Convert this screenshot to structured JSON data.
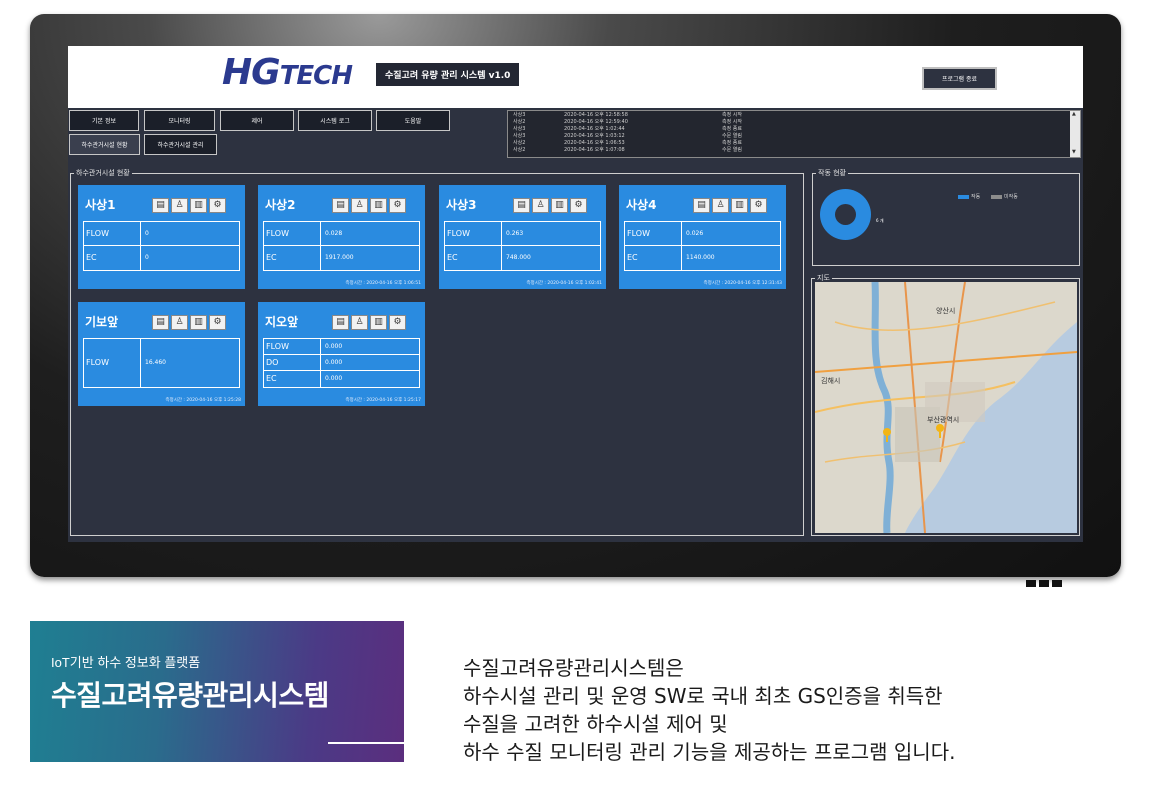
{
  "header": {
    "logo_main": "HG",
    "logo_rest": "TECH",
    "app_title": "수질고려 유량 관리 시스템 v1.0",
    "exit_label": "프로그램 종료"
  },
  "nav": {
    "row1": [
      "기본 정보",
      "모니터링",
      "제어",
      "시스템 로그",
      "도움말"
    ],
    "row2": [
      "하수관거시설 현황",
      "하수관거시설 관리"
    ]
  },
  "log": [
    {
      "site": "사상3",
      "time": "2020-04-16 오후 12:58:58",
      "event": "측정 시작"
    },
    {
      "site": "사상2",
      "time": "2020-04-16 오후 12:59:40",
      "event": "측정 시작"
    },
    {
      "site": "사상3",
      "time": "2020-04-16 오후 1:02:44",
      "event": "측정 종료"
    },
    {
      "site": "사상3",
      "time": "2020-04-16 오후 1:03:12",
      "event": "수문 열림"
    },
    {
      "site": "사상2",
      "time": "2020-04-16 오후 1:06:53",
      "event": "측정 종료"
    },
    {
      "site": "사상2",
      "time": "2020-04-16 오후 1:07:08",
      "event": "수문 열림"
    }
  ],
  "panels": {
    "facility_title": "하수관거시설 현황",
    "status_title": "작동 현황",
    "map_title": "지도"
  },
  "cards": [
    {
      "name": "사상1",
      "rows": [
        {
          "label": "FLOW",
          "value": "0"
        },
        {
          "label": "EC",
          "value": "0"
        }
      ],
      "time": ""
    },
    {
      "name": "사상2",
      "rows": [
        {
          "label": "FLOW",
          "value": "0.028"
        },
        {
          "label": "EC",
          "value": "1917.000"
        }
      ],
      "time": "측정시간 : 2020-04-16 오후 1:06:51"
    },
    {
      "name": "사상3",
      "rows": [
        {
          "label": "FLOW",
          "value": "0.263"
        },
        {
          "label": "EC",
          "value": "748.000"
        }
      ],
      "time": "측정시간 : 2020-04-16 오후 1:02:41"
    },
    {
      "name": "사상4",
      "rows": [
        {
          "label": "FLOW",
          "value": "0.026"
        },
        {
          "label": "EC",
          "value": "1140.000"
        }
      ],
      "time": "측정시간 : 2020-04-16 오후 12:31:43"
    },
    {
      "name": "기보앞",
      "rows": [
        {
          "label": "FLOW",
          "value": "16.460"
        }
      ],
      "time": "측정시간 : 2020-04-16 오후 1:25:28"
    },
    {
      "name": "지오앞",
      "rows": [
        {
          "label": "FLOW",
          "value": "0.000"
        },
        {
          "label": "DO",
          "value": "0.000"
        },
        {
          "label": "EC",
          "value": "0.000"
        }
      ],
      "time": "측정시간 : 2020-04-16 오후 1:25:17"
    }
  ],
  "status": {
    "donut_label": "6 개",
    "legend": [
      {
        "label": "작동",
        "color": "#2a8be0"
      },
      {
        "label": "미작동",
        "color": "#8c8c8c"
      }
    ],
    "active_fraction": 1.0
  },
  "map": {
    "places": [
      "양산시",
      "김해시",
      "부산광역시"
    ]
  },
  "colors": {
    "accent": "#2a8be0",
    "screen_bg": "#2d3240",
    "logo": "#2b3a8f"
  },
  "banner": {
    "subtitle": "IoT기반 하수 정보화 플랫폼",
    "title": "수질고려유량관리시스템"
  },
  "description": [
    "수질고려유량관리시스템은",
    "하수시설 관리 및 운영 SW로 국내 최초 GS인증을 취득한",
    "수질을 고려한 하수시설 제어 및",
    "하수 수질 모니터링 관리 기능을 제공하는 프로그램 입니다."
  ]
}
